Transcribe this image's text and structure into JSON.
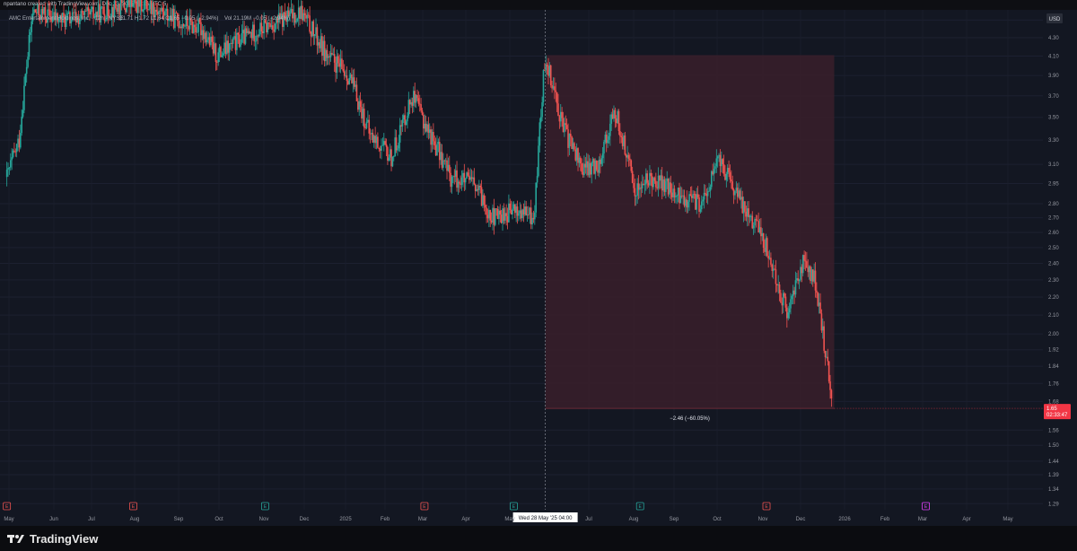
{
  "header": {
    "attribution": "npantano created with TradingView.com, Dec 23, 2025 13:26 UTC-5"
  },
  "legend": {
    "symbol": "AMC Entertainment Holdings, Inc. · 12h · NYSE",
    "ohlc": "O1.71 H1.72 L1.64 C1.65 −0.05 (−2.94%)",
    "volume": "Vol 21.19M −0.05 (−2.94%)"
  },
  "currency_label": "USD",
  "brand": "TradingView",
  "colors": {
    "background": "#131722",
    "up": "#26a69a",
    "down": "#ef5350",
    "measure_fill": "#3a1f2a",
    "price_badge": "#f23645"
  },
  "chart_data": {
    "type": "candlestick",
    "y_axis_ticks": [
      "4.50",
      "4.30",
      "4.10",
      "3.90",
      "3.70",
      "3.50",
      "3.30",
      "3.10",
      "2.95",
      "2.80",
      "2.70",
      "2.60",
      "2.50",
      "2.40",
      "2.30",
      "2.20",
      "2.10",
      "2.00",
      "1.92",
      "1.84",
      "1.76",
      "1.68",
      "1.56",
      "1.50",
      "1.44",
      "1.39",
      "1.34",
      "1.29"
    ],
    "y_scale": "log",
    "ylim": [
      1.27,
      4.62
    ],
    "x_axis_ticks": [
      "May",
      "Jun",
      "Jul",
      "Aug",
      "Sep",
      "Oct",
      "Nov",
      "Dec",
      "2025",
      "Feb",
      "Mar",
      "Apr",
      "May",
      "Jul",
      "Aug",
      "Sep",
      "Oct",
      "Nov",
      "Dec",
      "2026",
      "Feb",
      "Mar",
      "Apr",
      "May"
    ],
    "price_path": [
      {
        "date": "2024-05-01",
        "price": 3.0
      },
      {
        "date": "2024-05-10",
        "price": 3.3
      },
      {
        "date": "2024-05-20",
        "price": 4.6
      },
      {
        "date": "2024-06-10",
        "price": 4.5
      },
      {
        "date": "2024-07-01",
        "price": 4.55
      },
      {
        "date": "2024-07-20",
        "price": 4.65
      },
      {
        "date": "2024-08-10",
        "price": 4.7
      },
      {
        "date": "2024-09-01",
        "price": 4.5
      },
      {
        "date": "2024-09-20",
        "price": 4.4
      },
      {
        "date": "2024-10-01",
        "price": 4.1
      },
      {
        "date": "2024-10-20",
        "price": 4.3
      },
      {
        "date": "2024-11-10",
        "price": 4.45
      },
      {
        "date": "2024-12-01",
        "price": 4.6
      },
      {
        "date": "2024-12-20",
        "price": 4.1
      },
      {
        "date": "2025-01-05",
        "price": 3.9
      },
      {
        "date": "2025-01-20",
        "price": 3.35
      },
      {
        "date": "2025-02-05",
        "price": 3.15
      },
      {
        "date": "2025-02-20",
        "price": 3.7
      },
      {
        "date": "2025-03-05",
        "price": 3.35
      },
      {
        "date": "2025-03-20",
        "price": 3.0
      },
      {
        "date": "2025-04-05",
        "price": 2.95
      },
      {
        "date": "2025-04-20",
        "price": 2.7
      },
      {
        "date": "2025-05-05",
        "price": 2.75
      },
      {
        "date": "2025-05-20",
        "price": 2.7
      },
      {
        "date": "2025-05-28",
        "price": 4.11
      },
      {
        "date": "2025-06-10",
        "price": 3.4
      },
      {
        "date": "2025-06-25",
        "price": 3.05
      },
      {
        "date": "2025-07-05",
        "price": 3.1
      },
      {
        "date": "2025-07-18",
        "price": 3.55
      },
      {
        "date": "2025-08-01",
        "price": 2.9
      },
      {
        "date": "2025-08-15",
        "price": 3.0
      },
      {
        "date": "2025-09-01",
        "price": 2.85
      },
      {
        "date": "2025-09-20",
        "price": 2.8
      },
      {
        "date": "2025-10-01",
        "price": 3.15
      },
      {
        "date": "2025-10-15",
        "price": 2.85
      },
      {
        "date": "2025-11-01",
        "price": 2.6
      },
      {
        "date": "2025-11-20",
        "price": 2.1
      },
      {
        "date": "2025-12-01",
        "price": 2.4
      },
      {
        "date": "2025-12-10",
        "price": 2.3
      },
      {
        "date": "2025-12-23",
        "price": 1.65
      }
    ],
    "measure": {
      "start_date": "2025-05-28",
      "end_date": "2025-12-23",
      "high": 4.11,
      "low": 1.65,
      "label": "−2.46 (−60.05%)"
    },
    "crosshair_label": "Wed 28 May '25   04:00",
    "last_price": "1.65",
    "countdown": "02:33:47",
    "earnings_markers": [
      {
        "date": "2024-05-01",
        "color": "#ef5350"
      },
      {
        "date": "2024-08-01",
        "color": "#ef5350"
      },
      {
        "date": "2024-11-05",
        "color": "#26a69a"
      },
      {
        "date": "2025-03-01",
        "color": "#ef5350"
      },
      {
        "date": "2025-05-05",
        "color": "#26a69a"
      },
      {
        "date": "2025-08-05",
        "color": "#26a69a"
      },
      {
        "date": "2025-11-05",
        "color": "#ef5350"
      },
      {
        "date": "2026-03-01",
        "color": "#e040fb"
      }
    ]
  }
}
